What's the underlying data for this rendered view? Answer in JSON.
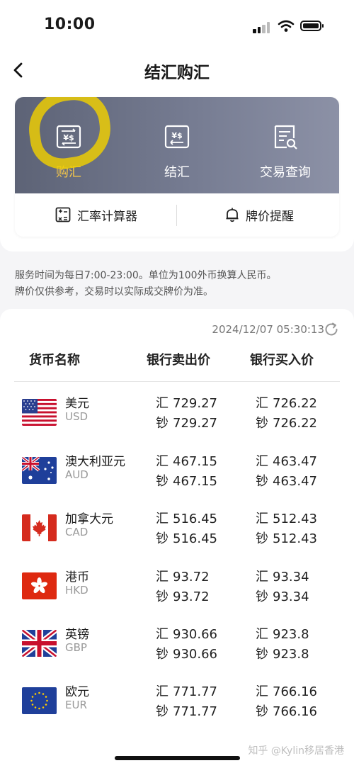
{
  "status_bar": {
    "time": "10:00"
  },
  "nav": {
    "title": "结汇购汇"
  },
  "actions": [
    {
      "label": "购汇",
      "icon": "exchange-in-icon",
      "active": true
    },
    {
      "label": "结汇",
      "icon": "exchange-out-icon",
      "active": false
    },
    {
      "label": "交易查询",
      "icon": "document-search-icon",
      "active": false
    }
  ],
  "tools": [
    {
      "label": "汇率计算器",
      "icon": "calculator-icon"
    },
    {
      "label": "牌价提醒",
      "icon": "bell-icon"
    }
  ],
  "notice": {
    "line1": "服务时间为每日7:00-23:00。单位为100外币换算人民币。",
    "line2": "牌价仅供参考，交易时以实际成交牌价为准。"
  },
  "rates": {
    "updated": "2024/12/07 05:30:13",
    "headers": {
      "currency": "货币名称",
      "sell": "银行卖出价",
      "buy": "银行买入价"
    },
    "prefix_transfer": "汇",
    "prefix_cash": "钞",
    "rows": [
      {
        "name": "美元",
        "code": "USD",
        "sell_transfer": "729.27",
        "sell_cash": "729.27",
        "buy_transfer": "726.22",
        "buy_cash": "726.22"
      },
      {
        "name": "澳大利亚元",
        "code": "AUD",
        "sell_transfer": "467.15",
        "sell_cash": "467.15",
        "buy_transfer": "463.47",
        "buy_cash": "463.47"
      },
      {
        "name": "加拿大元",
        "code": "CAD",
        "sell_transfer": "516.45",
        "sell_cash": "516.45",
        "buy_transfer": "512.43",
        "buy_cash": "512.43"
      },
      {
        "name": "港币",
        "code": "HKD",
        "sell_transfer": "93.72",
        "sell_cash": "93.72",
        "buy_transfer": "93.34",
        "buy_cash": "93.34"
      },
      {
        "name": "英镑",
        "code": "GBP",
        "sell_transfer": "930.66",
        "sell_cash": "930.66",
        "buy_transfer": "923.8",
        "buy_cash": "923.8"
      },
      {
        "name": "欧元",
        "code": "EUR",
        "sell_transfer": "771.77",
        "sell_cash": "771.77",
        "buy_transfer": "766.16",
        "buy_cash": "766.16"
      }
    ]
  },
  "watermark": "知乎 @Kylin移居香港",
  "colors": {
    "accent": "#f3c64a",
    "banner": "#6d7388",
    "highlight": "#f0d000"
  }
}
